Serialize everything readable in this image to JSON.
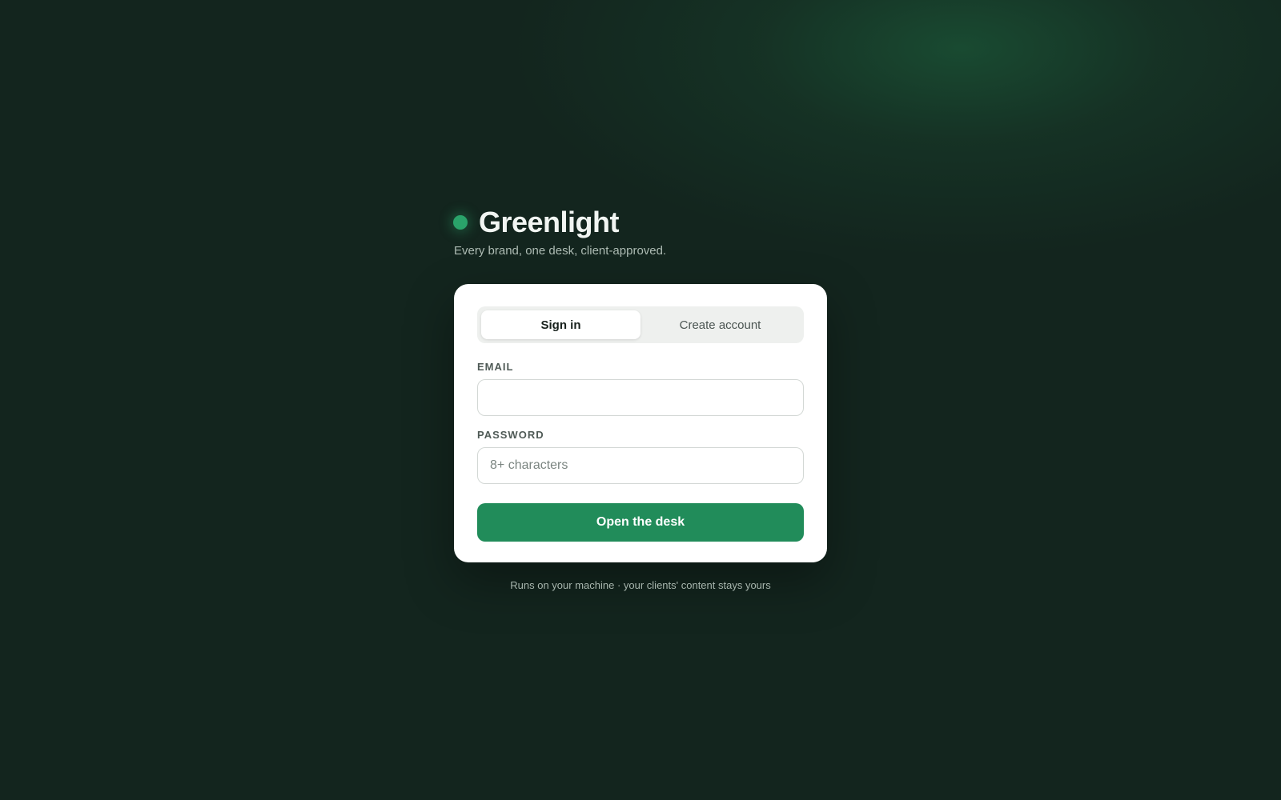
{
  "brand": {
    "name": "Greenlight",
    "tagline": "Every brand, one desk, client-approved.",
    "accent_color": "#2aa36a",
    "logo_icon": "green-dot-icon"
  },
  "auth": {
    "tabs": [
      {
        "label": "Sign in",
        "active": true
      },
      {
        "label": "Create account",
        "active": false
      }
    ],
    "email": {
      "label": "EMAIL",
      "value": "",
      "placeholder": ""
    },
    "password": {
      "label": "PASSWORD",
      "value": "",
      "placeholder": "8+ characters"
    },
    "submit_label": "Open the desk",
    "button_color": "#218c5a"
  },
  "footer": {
    "note": "Runs on your machine · your clients' content stays yours"
  }
}
